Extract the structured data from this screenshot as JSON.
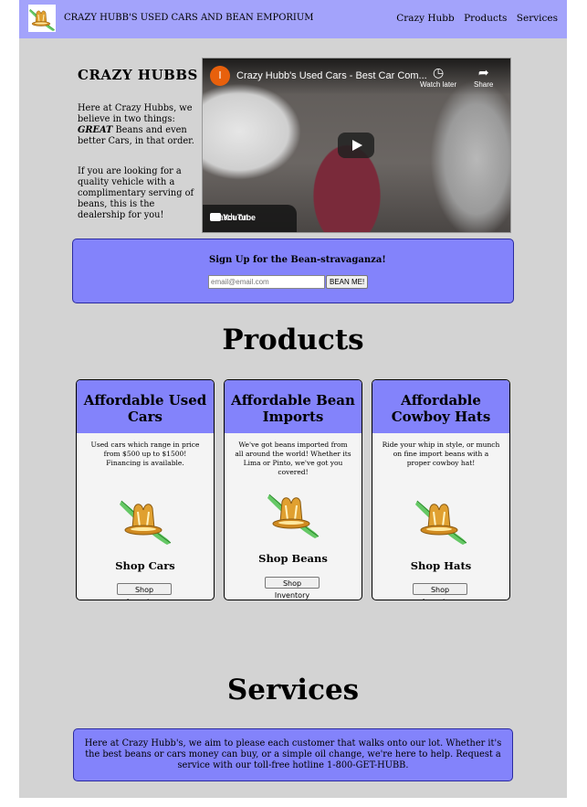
{
  "navbar": {
    "brand": "CRAZY HUBB'S USED CARS AND BEAN EMPORIUM",
    "links": [
      "Crazy Hubb",
      "Products",
      "Services"
    ],
    "logo_icon": "cowboy-hat-logo-icon"
  },
  "intro": {
    "title": "CRAZY HUBBS",
    "p1_before": "Here at Crazy Hubbs, we believe in two things: ",
    "p1_emph": "GREAT",
    "p1_after": " Beans and even better Cars, in that order.",
    "p2": "If you are looking for a quality vehicle with a complimentary serving of beans, this is the dealership for you!"
  },
  "video": {
    "channel_initial": "I",
    "title": "Crazy Hubb's Used Cars - Best Car Com...",
    "watch_later": "Watch later",
    "share": "Share",
    "watch_on": "Watch on",
    "youtube": "YouTube"
  },
  "signup": {
    "title": "Sign Up for the Bean-stravaganza!",
    "placeholder": "email@email.com",
    "button": "BEAN ME!"
  },
  "products": {
    "title": "Products",
    "cards": [
      {
        "title": "Affordable Used Cars",
        "desc": "Used cars which range in price from $500 up to $1500! Financing is available.",
        "shop": "Shop Cars",
        "button": "Shop Inventory"
      },
      {
        "title": "Affordable Bean Imports",
        "desc": "We've got beans imported from all around the world! Whether its Lima or Pinto, we've got you covered!",
        "shop": "Shop Beans",
        "button": "Shop Inventory"
      },
      {
        "title": "Affordable Cowboy Hats",
        "desc": "Ride your whip in style, or munch on fine import beans with a proper cowboy hat!",
        "shop": "Shop Hats",
        "button": "Shop Inventory"
      }
    ]
  },
  "services": {
    "title": "Services",
    "text": "Here at Crazy Hubb's, we aim to please each customer that walks onto our lot. Whether it's the best beans or cars money can buy, or a simple oil change, we're here to help. Request a service with our toll-free hotline 1-800-GET-HUBB."
  },
  "colors": {
    "navbar": "#a3a3fb",
    "accent": "#8383fb",
    "page_bg": "#d3d3d3"
  }
}
